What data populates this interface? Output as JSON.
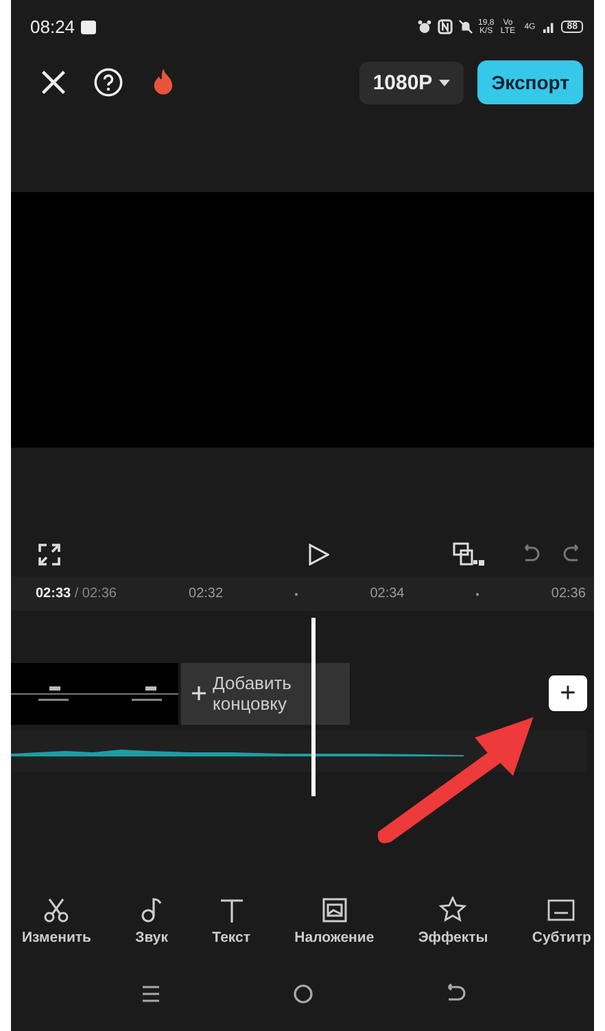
{
  "status_bar": {
    "time": "08:24",
    "net_speed": "19,8",
    "net_unit": "K/S",
    "volte": "Vo LTE",
    "network": "4G",
    "battery": "88"
  },
  "top_bar": {
    "resolution": "1080P",
    "export_button": "Экспорт"
  },
  "timeline": {
    "current_time": "02:33",
    "total_time": "/ 02:36",
    "ticks": [
      {
        "kind": "label",
        "text": "02:32"
      },
      {
        "kind": "dot"
      },
      {
        "kind": "label",
        "text": "02:34"
      },
      {
        "kind": "dot"
      },
      {
        "kind": "label",
        "text": "02:36"
      }
    ],
    "add_ending": "Добавить концовку",
    "add_button": "+"
  },
  "toolbar": [
    {
      "kind": "scissors",
      "label": "Изменить"
    },
    {
      "kind": "note",
      "label": "Звук"
    },
    {
      "kind": "text",
      "label": "Текст"
    },
    {
      "kind": "overlay",
      "label": "Наложение"
    },
    {
      "kind": "effects",
      "label": "Эффекты"
    },
    {
      "kind": "subtitles",
      "label": "Субтитр"
    }
  ]
}
